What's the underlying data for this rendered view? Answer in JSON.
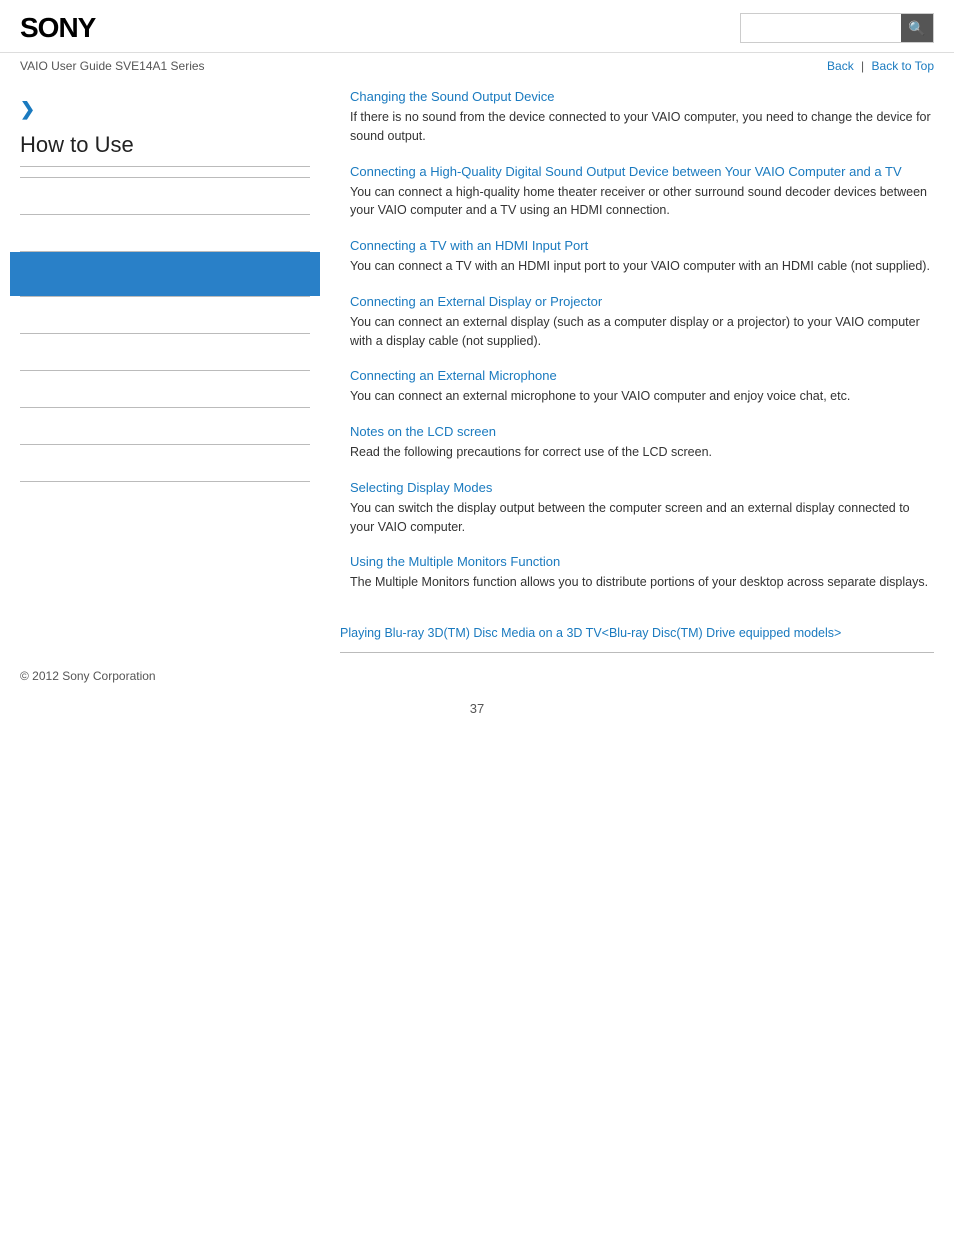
{
  "header": {
    "logo": "SONY",
    "search_placeholder": ""
  },
  "subheader": {
    "guide_title": "VAIO User Guide SVE14A1 Series",
    "back_label": "Back",
    "back_to_top_label": "Back to Top"
  },
  "sidebar": {
    "arrow": "❯",
    "title": "How to Use",
    "items": [
      {
        "label": ""
      },
      {
        "label": ""
      },
      {
        "label": "",
        "active": true
      },
      {
        "label": ""
      },
      {
        "label": ""
      },
      {
        "label": ""
      },
      {
        "label": ""
      },
      {
        "label": ""
      }
    ]
  },
  "content": {
    "sections": [
      {
        "id": "section-1",
        "link": "Changing the Sound Output Device",
        "desc": "If there is no sound from the device connected to your VAIO computer, you need to change the device for sound output."
      },
      {
        "id": "section-2",
        "link": "Connecting a High-Quality Digital Sound Output Device between Your VAIO Computer and a TV",
        "desc": "You can connect a high-quality home theater receiver or other surround sound decoder devices between your VAIO computer and a TV using an HDMI connection."
      },
      {
        "id": "section-3",
        "link": "Connecting a TV with an HDMI Input Port",
        "desc": "You can connect a TV with an HDMI input port to your VAIO computer with an HDMI cable (not supplied)."
      },
      {
        "id": "section-4",
        "link": "Connecting an External Display or Projector",
        "desc": "You can connect an external display (such as a computer display or a projector) to your VAIO computer with a display cable (not supplied)."
      },
      {
        "id": "section-5",
        "link": "Connecting an External Microphone",
        "desc": "You can connect an external microphone to your VAIO computer and enjoy voice chat, etc."
      },
      {
        "id": "section-6",
        "link": "Notes on the LCD screen",
        "desc": "Read the following precautions for correct use of the LCD screen."
      },
      {
        "id": "section-7",
        "link": "Selecting Display Modes",
        "desc": "You can switch the display output between the computer screen and an external display connected to your VAIO computer."
      },
      {
        "id": "section-8",
        "link": "Using the Multiple Monitors Function",
        "desc": "The Multiple Monitors function allows you to distribute portions of your desktop across separate displays."
      }
    ],
    "bottom_link": "Playing Blu-ray 3D(TM) Disc Media on a 3D TV<Blu-ray Disc(TM) Drive equipped models>"
  },
  "footer": {
    "copyright": "© 2012 Sony Corporation"
  },
  "page": {
    "number": "37"
  }
}
